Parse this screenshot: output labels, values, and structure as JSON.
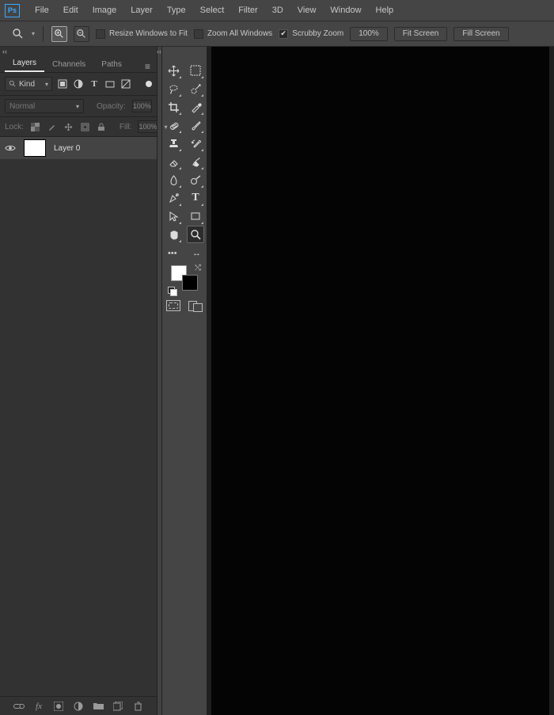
{
  "app": {
    "logo_text": "Ps"
  },
  "menu": {
    "items": [
      "File",
      "Edit",
      "Image",
      "Layer",
      "Type",
      "Select",
      "Filter",
      "3D",
      "View",
      "Window",
      "Help"
    ]
  },
  "options": {
    "resize_label": "Resize Windows to Fit",
    "zoom_all_label": "Zoom All Windows",
    "scrubby_label": "Scrubby Zoom",
    "zoom_pct": "100%",
    "fit_btn": "Fit Screen",
    "fill_btn": "Fill Screen"
  },
  "panel": {
    "tabs": [
      "Layers",
      "Channels",
      "Paths"
    ],
    "filter_kind": "Kind",
    "blend_mode": "Normal",
    "opacity_label": "Opacity:",
    "opacity_value": "100%",
    "lock_label": "Lock:",
    "fill_label": "Fill:",
    "fill_value": "100%",
    "layers": [
      {
        "name": "Layer 0"
      }
    ]
  },
  "tools": {
    "tab_hint": "",
    "names": [
      "move",
      "marquee",
      "lasso",
      "quick-select",
      "crop",
      "eyedropper",
      "spot-heal",
      "brush",
      "clone",
      "history-brush",
      "eraser",
      "paint-bucket",
      "dodge",
      "blur",
      "pen",
      "type",
      "path-select",
      "shape",
      "hand",
      "zoom"
    ]
  }
}
